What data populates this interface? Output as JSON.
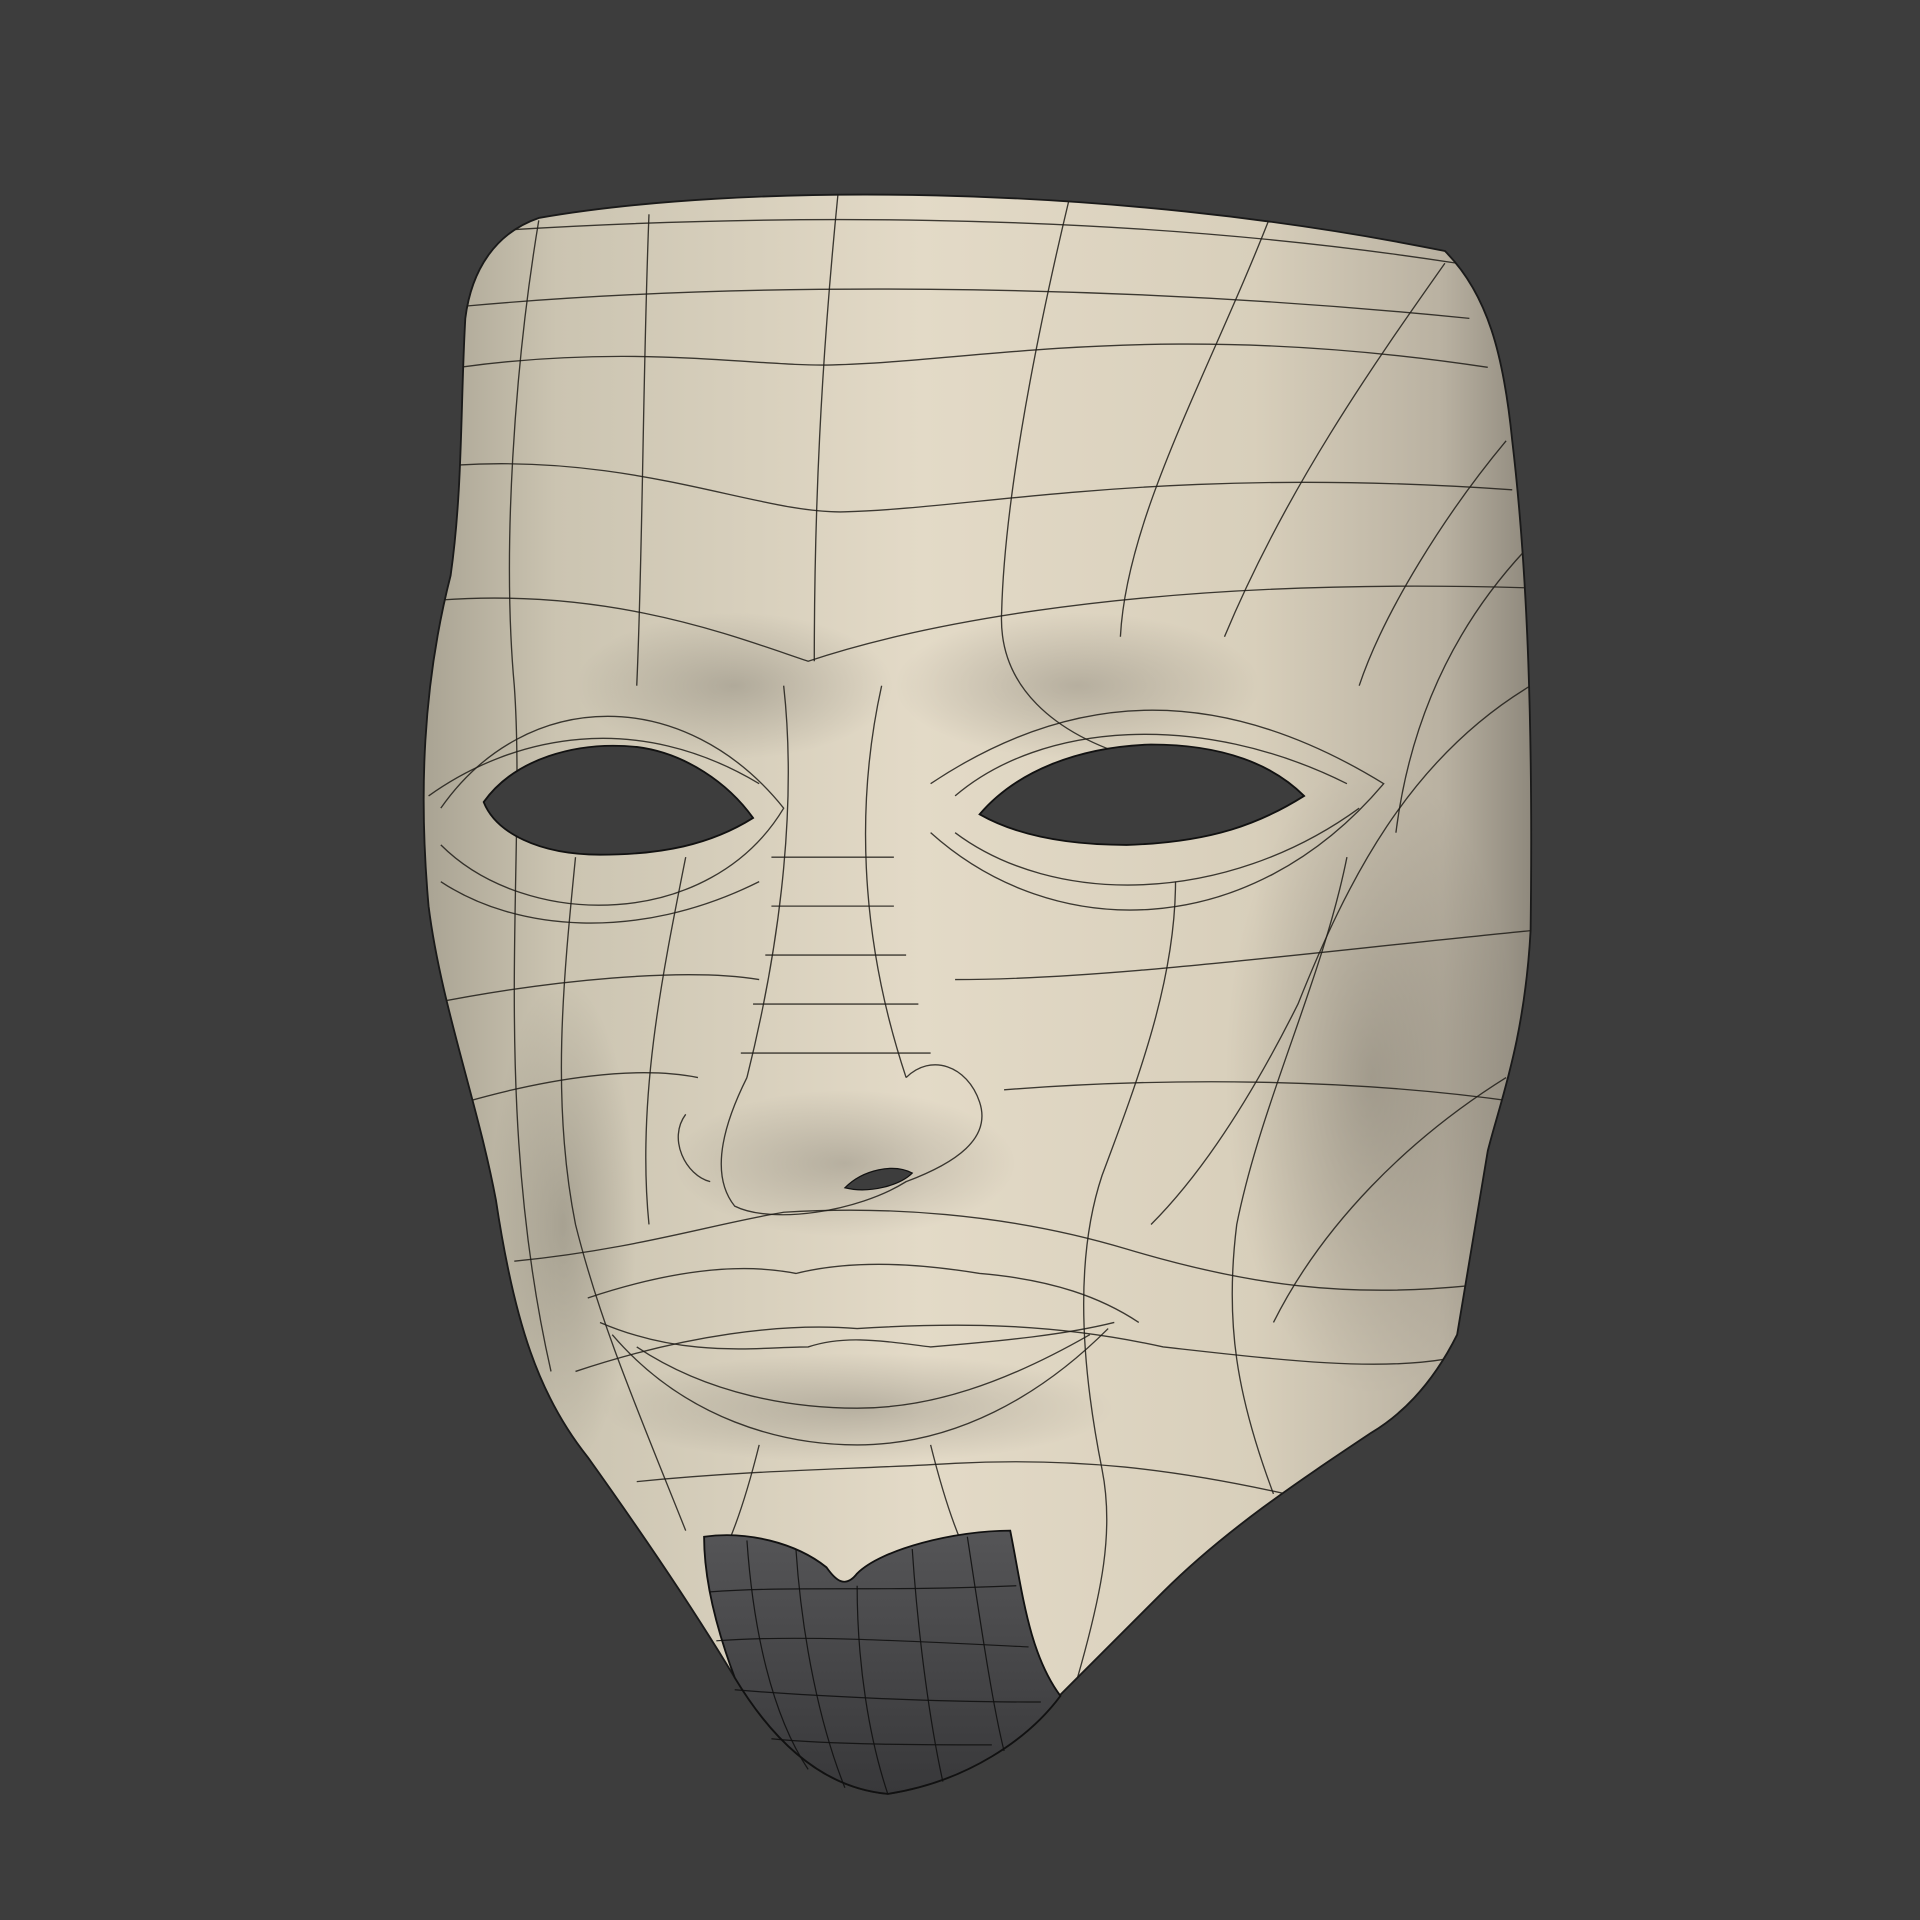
{
  "scene": {
    "subject": "mask-wireframe-render",
    "colors": {
      "background": "#3d3d3d",
      "mask_light": "#e3dac7",
      "mask_mid": "#cfc6b2",
      "mask_shadow": "#9e978a",
      "hole": "#3d3d3d",
      "goatee": "#4a4a4c",
      "wire": "#1e1c18"
    }
  }
}
